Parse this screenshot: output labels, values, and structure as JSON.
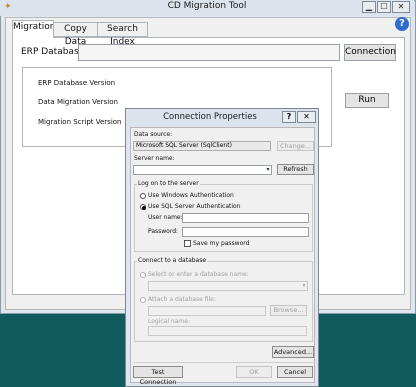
{
  "main_window": {
    "title": "CD Migration Tool",
    "caption_buttons": {
      "minimize": "▁",
      "maximize": "☐",
      "close": "✕"
    },
    "help_icon": "?",
    "tabs": [
      {
        "label": "Migration",
        "active": true
      },
      {
        "label": "Copy Data",
        "active": false
      },
      {
        "label": "Search Index",
        "active": false
      }
    ],
    "erp_database_label": "ERP Database",
    "erp_database_value": "",
    "connection_button": "Connection",
    "info": {
      "erp_version_label": "ERP Database Version",
      "data_migration_version_label": "Data Migration Version",
      "migration_script_version_label": "Migration Script Version"
    },
    "run_button": "Run"
  },
  "dialog": {
    "title": "Connection Properties",
    "help_button": "?",
    "close_button": "✕",
    "data_source_label": "Data source:",
    "data_source_value": "Microsoft SQL Server (SqlClient)",
    "change_button": "Change...",
    "server_name_label": "Server name:",
    "server_name_value": "",
    "refresh_button": "Refresh",
    "logon_group_label": "Log on to the server",
    "auth_windows": "Use Windows Authentication",
    "auth_sql": "Use SQL Server Authentication",
    "auth_selected": "sql",
    "user_name_label": "User name:",
    "user_name_value": "",
    "password_label": "Password:",
    "password_value": "",
    "save_password_label": "Save my password",
    "save_password_checked": false,
    "connect_group_label": "Connect to a database",
    "select_db_label": "Select or enter a database name:",
    "select_db_value": "",
    "attach_label": "Attach a database file:",
    "attach_value": "",
    "browse_button": "Browse...",
    "logical_name_label": "Logical name:",
    "logical_name_value": "",
    "advanced_button": "Advanced...",
    "test_button": "Test Connection",
    "ok_button": "OK",
    "cancel_button": "Cancel"
  },
  "icons": {
    "app": "app-icon",
    "dropdown": "▾",
    "help": "question-icon"
  },
  "colors": {
    "desktop": "#0f5b5e",
    "help_blue": "#2f6bd0"
  }
}
